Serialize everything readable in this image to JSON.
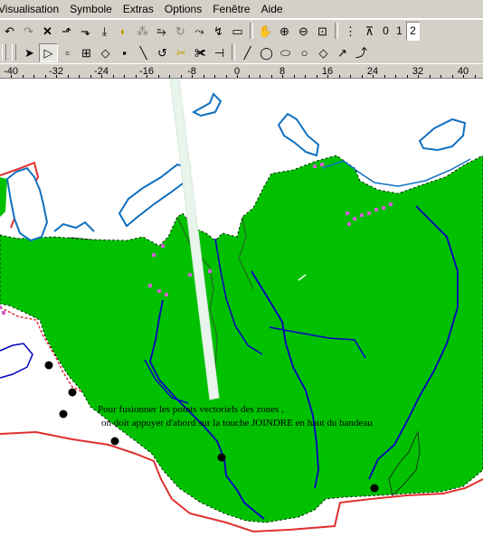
{
  "menu": [
    "Visualisation",
    "Symbole",
    "Extras",
    "Options",
    "Fenêtre",
    "Aide"
  ],
  "toolbar1": {
    "icons": [
      "undo-icon",
      "redo-icon",
      "delete-icon",
      "move-up-icon",
      "move-down-icon",
      "move-bottom-icon",
      "select-color-icon",
      "group-icon",
      "ungroup-icon",
      "rotate-icon",
      "join-icon",
      "measure-icon",
      "hand-icon",
      "zoom-in-icon",
      "zoom-out-icon",
      "zoom-fit-icon",
      "grid-icon",
      "snap-icon"
    ],
    "layer_buttons": [
      "0",
      "1",
      "2"
    ]
  },
  "toolbar2": {
    "icons": [
      "pointer-icon",
      "vertex-pointer-icon",
      "node-square-icon",
      "node-plus-icon",
      "node-diamond-icon",
      "node-end-icon",
      "line-icon",
      "arc-icon",
      "cut-icon",
      "scissors-icon",
      "split-icon",
      "straight-line-icon",
      "freehand-icon",
      "ellipse-icon",
      "circle-icon",
      "rectangle-icon",
      "curve-icon",
      "polyline-icon"
    ]
  },
  "ruler": {
    "labels": [
      "-40",
      "-32",
      "-24",
      "-16",
      "-8",
      "0",
      "8",
      "16",
      "24",
      "32",
      "40"
    ]
  },
  "map": {
    "caption_line1": "Pour fusionner les points vectoriels des zones ,",
    "caption_line2": "on doit appuyer d'abord sur la touche JOINDRE en haut du bandeau",
    "colors": {
      "area": "#00c000",
      "river": "#0000c0",
      "coast": "#1070c0",
      "border": "#e03030",
      "dots": "#d060d0",
      "background": "#ffffff"
    }
  }
}
